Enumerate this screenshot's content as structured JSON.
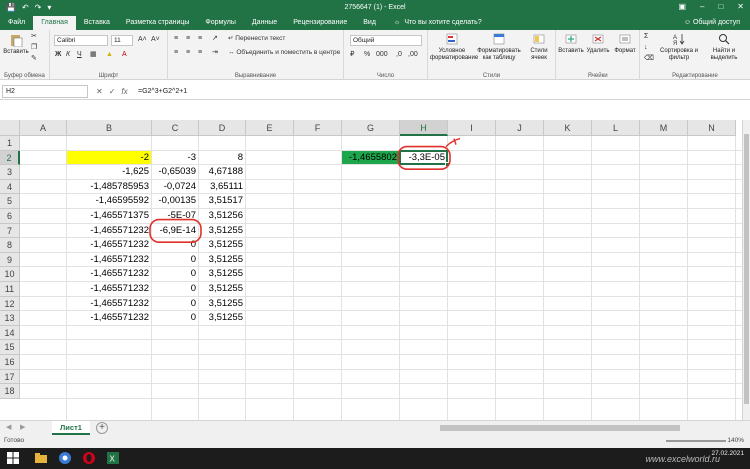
{
  "window": {
    "title": "2756647 (1) - Excel",
    "share": "Общий доступ"
  },
  "ribbon": {
    "tabs": [
      "Файл",
      "Главная",
      "Вставка",
      "Разметка страницы",
      "Формулы",
      "Данные",
      "Рецензирование",
      "Вид"
    ],
    "active_tab": "Главная",
    "tell_me": "Что вы хотите сделать?",
    "paste_label": "Вставить",
    "font_name": "Calibri",
    "font_size": "11",
    "wrap_text": "Перенести текст",
    "merge_center": "Объединить и поместить в центре",
    "number_format": "Общий",
    "cond_format": "Условное форматирование",
    "format_table": "Форматировать как таблицу",
    "cell_styles": "Стили ячеек",
    "insert": "Вставить",
    "delete": "Удалить",
    "format": "Формат",
    "sort_filter": "Сортировка и фильтр",
    "find_select": "Найти и выделить",
    "groups": {
      "clipboard": "Буфер обмена",
      "font": "Шрифт",
      "alignment": "Выравнивание",
      "number": "Число",
      "styles": "Стили",
      "cells": "Ячейки",
      "editing": "Редактирование"
    }
  },
  "formula_bar": {
    "name_box": "H2",
    "formula": "=G2^3+G2^2+1"
  },
  "sheet": {
    "columns": [
      "A",
      "B",
      "C",
      "D",
      "E",
      "F",
      "G",
      "H",
      "I",
      "J",
      "K",
      "L",
      "M",
      "N"
    ],
    "rows": [
      "1",
      "2",
      "3",
      "4",
      "5",
      "6",
      "7",
      "8",
      "9",
      "10",
      "11",
      "12",
      "13",
      "14",
      "15",
      "16",
      "17",
      "18"
    ],
    "selected_cell": "H2",
    "cells": {
      "B2": "-2",
      "C2": "-3",
      "D2": "8",
      "G2": "-1,4655802",
      "H2": "-3,3E-05",
      "B3": "-1,625",
      "C3": "-0,65039",
      "D3": "4,67188",
      "B4": "-1,485785953",
      "C4": "-0,0724",
      "D4": "3,65111",
      "B5": "-1,46595592",
      "C5": "-0,00135",
      "D5": "3,51517",
      "B6": "-1,465571375",
      "C6": "-5E-07",
      "D6": "3,51256",
      "B7": "-1,465571232",
      "C7": "-6,9E-14",
      "D7": "3,51255",
      "B8": "-1,465571232",
      "C8": "0",
      "D8": "3,51255",
      "B9": "-1,465571232",
      "C9": "0",
      "D9": "3,51255",
      "B10": "-1,465571232",
      "C10": "0",
      "D10": "3,51255",
      "B11": "-1,465571232",
      "C11": "0",
      "D11": "3,51255",
      "B12": "-1,465571232",
      "C12": "0",
      "D12": "3,51255",
      "B13": "-1,465571232",
      "C13": "0",
      "D13": "3,51255"
    },
    "fill_colors": {
      "B2": "#ffff00",
      "G2": "#1ea64c"
    },
    "annotation_color": "#e0302a"
  },
  "sheet_tabs": {
    "active": "Лист1"
  },
  "status": {
    "ready": "Готово",
    "zoom": "140%"
  },
  "taskbar": {
    "date": "27.02.2021",
    "watermark": "www.excelworld.ru"
  }
}
